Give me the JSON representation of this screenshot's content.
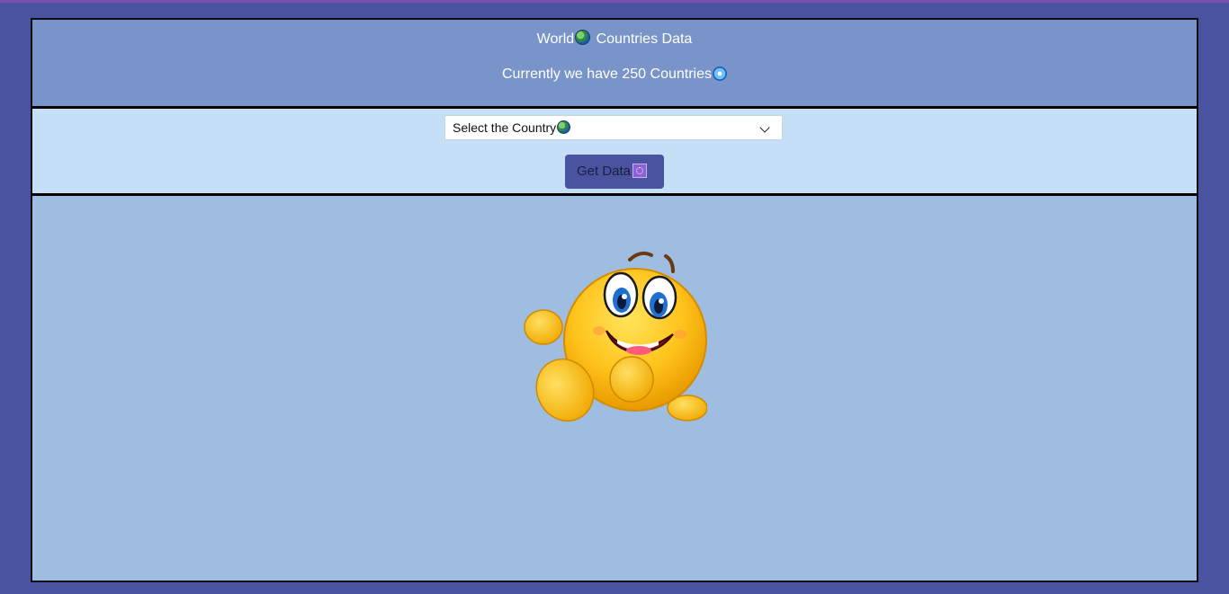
{
  "header": {
    "title_prefix": "World",
    "title_suffix": " Countries Data",
    "subtitle": "Currently we have 250 Countries",
    "globe_icon": "globe-icon",
    "disk_icon": "dvd-icon"
  },
  "controls": {
    "select": {
      "selected_label": "Select the Country",
      "icon": "globe-icon"
    },
    "button": {
      "label": "Get Data",
      "icon": "wheel-of-dharma-icon"
    }
  },
  "content": {
    "illustration": "smiley-emoji-walking"
  },
  "colors": {
    "page_bg": "#4a53a0",
    "header_bg": "#7894c8",
    "controls_bg": "#c4dff6",
    "content_bg": "#9fbde0",
    "button_bg": "#4a53a0"
  }
}
